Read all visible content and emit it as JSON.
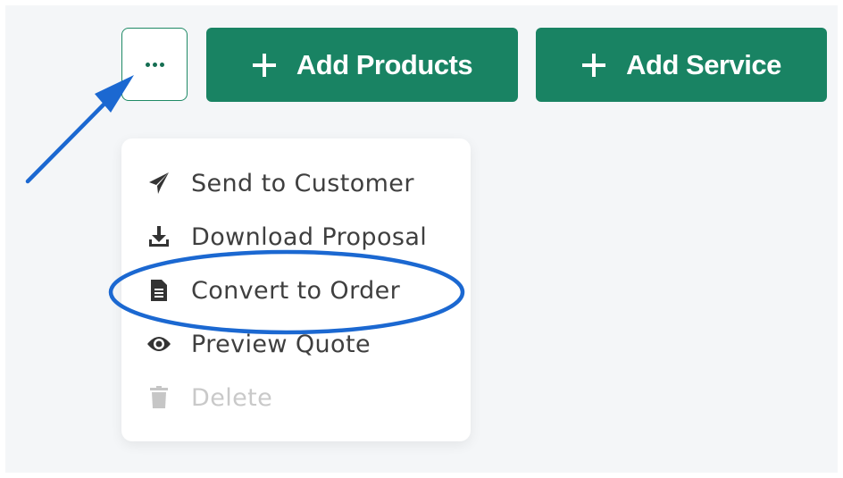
{
  "toolbar": {
    "more_label": "More actions",
    "add_products_label": "Add Products",
    "add_service_label": "Add Service"
  },
  "menu": {
    "items": [
      {
        "label": "Send to Customer",
        "icon": "paper-plane-icon",
        "enabled": true
      },
      {
        "label": "Download Proposal",
        "icon": "download-icon",
        "enabled": true
      },
      {
        "label": "Convert to Order",
        "icon": "document-icon",
        "enabled": true,
        "highlighted": true
      },
      {
        "label": "Preview Quote",
        "icon": "eye-icon",
        "enabled": true
      },
      {
        "label": "Delete",
        "icon": "trash-icon",
        "enabled": false
      }
    ]
  },
  "colors": {
    "primary": "#198363",
    "annotation": "#1b68d1",
    "background": "#f4f6f8",
    "menu_text": "#3f3f3f",
    "disabled_text": "#c9c9c9"
  }
}
